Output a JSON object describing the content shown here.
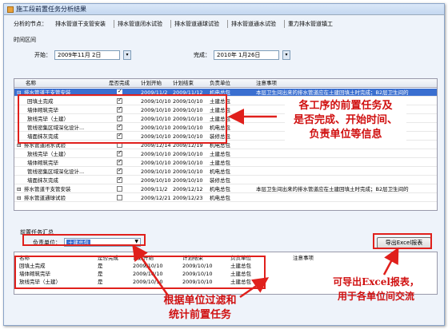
{
  "window": {
    "title": "施工段前置任务分析结果"
  },
  "analysis": {
    "label": "分析的节点：",
    "nodes": [
      "排水管道干支管安装",
      "排水管道闭水试验",
      "排水管道通球试验",
      "排水管道通水试验",
      "重力排水管道镇工"
    ]
  },
  "period": {
    "label": "时间区间",
    "start_label": "开始：",
    "start_value": "2009年11月 2日",
    "end_label": "完成：",
    "end_value": "2010年 1月26日"
  },
  "grid": {
    "headers": [
      "名称",
      "是否完成",
      "计划开始",
      "计划结束",
      "负责单位",
      "注意事项"
    ],
    "rows": [
      {
        "name": "排水管道干支管安装",
        "done": true,
        "start": "2009/11/2",
        "end": "2009/11/12",
        "unit": "机电总包",
        "note": "本层卫生间出来的排水管道应在土建回填土时完成；B2层卫生间的",
        "selected": true,
        "group": true
      },
      {
        "name": "回填土完成",
        "done": true,
        "start": "2009/10/10",
        "end": "2009/10/10",
        "unit": "土建总包",
        "note": ""
      },
      {
        "name": "墙体砌筑完毕",
        "done": true,
        "start": "2009/10/10",
        "end": "2009/10/10",
        "unit": "土建总包",
        "note": ""
      },
      {
        "name": "放线完毕（土建）",
        "done": true,
        "start": "2009/10/10",
        "end": "2009/10/10",
        "unit": "土建总包",
        "note": ""
      },
      {
        "name": "管线密集区域深化设计...",
        "done": true,
        "start": "2009/10/10",
        "end": "2009/10/10",
        "unit": "机电总包",
        "note": ""
      },
      {
        "name": "墙面抹灰完成",
        "done": true,
        "start": "2009/10/10",
        "end": "2009/10/10",
        "unit": "装修总包",
        "note": ""
      },
      {
        "name": "排水管道闭水试验",
        "done": false,
        "start": "2009/12/14",
        "end": "2009/12/19",
        "unit": "机电总包",
        "note": "",
        "group": true
      },
      {
        "name": "放线完毕（土建）",
        "done": true,
        "start": "2009/10/10",
        "end": "2009/10/10",
        "unit": "土建总包",
        "note": ""
      },
      {
        "name": "墙体砌筑完毕",
        "done": true,
        "start": "2009/10/10",
        "end": "2009/10/10",
        "unit": "土建总包",
        "note": ""
      },
      {
        "name": "管线密集区域深化设计...",
        "done": true,
        "start": "2009/10/10",
        "end": "2009/10/10",
        "unit": "机电总包",
        "note": ""
      },
      {
        "name": "墙面抹灰完成",
        "done": true,
        "start": "2009/10/10",
        "end": "2009/10/10",
        "unit": "装修总包",
        "note": ""
      },
      {
        "name": "排水管道干支管安装",
        "done": false,
        "start": "2009/11/2",
        "end": "2009/12/12",
        "unit": "机电总包",
        "note": "本层卫生间出来的排水管道应在土建回填土时完成；B2层卫生间的",
        "group": true
      },
      {
        "name": "排水管道通球试验",
        "done": false,
        "start": "2009/12/21",
        "end": "2009/12/23",
        "unit": "机电总包",
        "note": "",
        "group": true
      }
    ]
  },
  "callouts": {
    "top": [
      "各工序的前置任务及",
      "是否完成、开始时间、",
      "负责单位等信息"
    ],
    "bottom_left": [
      "根据单位过滤和",
      "统计前置任务"
    ],
    "bottom_right": [
      "可导出Excel报表，",
      "用于各单位间交流"
    ]
  },
  "summary": {
    "title": "前置任务汇总",
    "filter_label": "负责单位：",
    "filter_value": "土建总包",
    "export_label": "导出Excel报表",
    "headers": [
      "名称",
      "是否完成",
      "计划开始",
      "计划结束",
      "负责单位",
      "注意事项"
    ],
    "rows": [
      {
        "name": "回填土完成",
        "done": "是",
        "start": "2009/10/10",
        "end": "2009/10/10",
        "unit": "土建总包"
      },
      {
        "name": "墙体砌筑完毕",
        "done": "是",
        "start": "2009/10/10",
        "end": "2009/10/10",
        "unit": "土建总包"
      },
      {
        "name": "放线完毕（土建）",
        "done": "是",
        "start": "2009/10/10",
        "end": "2009/10/10",
        "unit": "土建总包"
      }
    ]
  },
  "colors": {
    "accent": "#e0201c",
    "selection": "#3a6fd0"
  }
}
